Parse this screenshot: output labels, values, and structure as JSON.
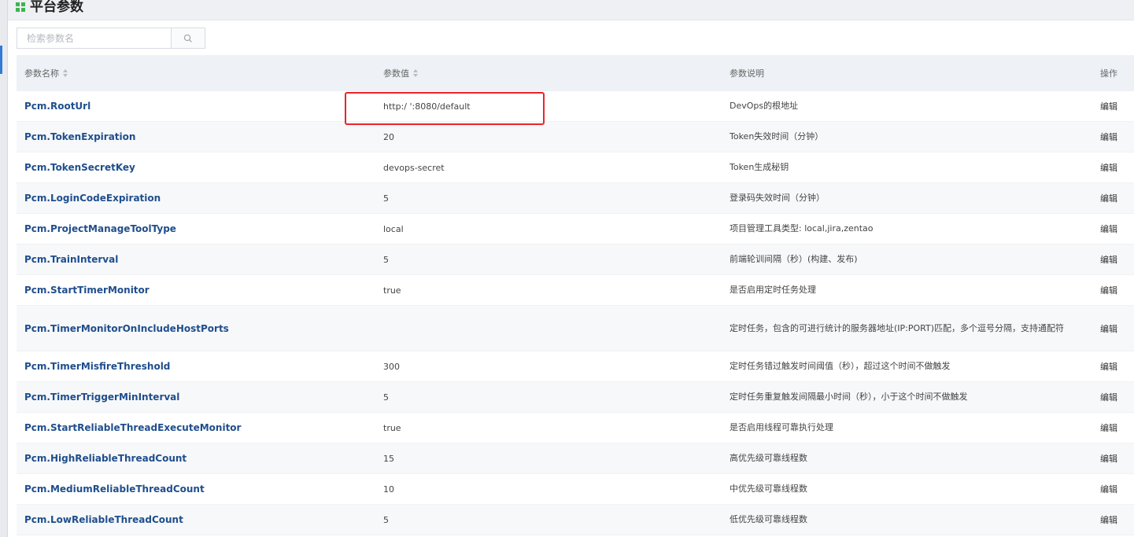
{
  "header": {
    "title": "平台参数"
  },
  "search": {
    "placeholder": "检索参数名"
  },
  "table": {
    "columns": [
      "参数名称",
      "参数值",
      "参数说明",
      "操作"
    ],
    "rows": [
      {
        "name": "Pcm.RootUrl",
        "value": "http:/                    ':8080/default",
        "desc": "DevOps的根地址",
        "op": "编辑"
      },
      {
        "name": "Pcm.TokenExpiration",
        "value": "20",
        "desc": "Token失效时间（分钟）",
        "op": "编辑"
      },
      {
        "name": "Pcm.TokenSecretKey",
        "value": "devops-secret",
        "desc": "Token生成秘钥",
        "op": "编辑"
      },
      {
        "name": "Pcm.LoginCodeExpiration",
        "value": "5",
        "desc": "登录码失效时间（分钟）",
        "op": "编辑"
      },
      {
        "name": "Pcm.ProjectManageToolType",
        "value": "local",
        "desc": "项目管理工具类型: local,jira,zentao",
        "op": "编辑"
      },
      {
        "name": "Pcm.TrainInterval",
        "value": "5",
        "desc": "前端轮训间隔（秒）(构建、发布)",
        "op": "编辑"
      },
      {
        "name": "Pcm.StartTimerMonitor",
        "value": "true",
        "desc": "是否启用定时任务处理",
        "op": "编辑"
      },
      {
        "name": "Pcm.TimerMonitorOnIncludeHostPorts",
        "value": "",
        "desc": "定时任务，包含的可进行统计的服务器地址(IP:PORT)匹配，多个逗号分隔，支持通配符",
        "op": "编辑"
      },
      {
        "name": "Pcm.TimerMisfireThreshold",
        "value": "300",
        "desc": "定时任务错过触发时间阈值（秒），超过这个时间不做触发",
        "op": "编辑"
      },
      {
        "name": "Pcm.TimerTriggerMinInterval",
        "value": "5",
        "desc": "定时任务重复触发间隔最小时间（秒），小于这个时间不做触发",
        "op": "编辑"
      },
      {
        "name": "Pcm.StartReliableThreadExecuteMonitor",
        "value": "true",
        "desc": "是否启用线程可靠执行处理",
        "op": "编辑"
      },
      {
        "name": "Pcm.HighReliableThreadCount",
        "value": "15",
        "desc": "高优先级可靠线程数",
        "op": "编辑"
      },
      {
        "name": "Pcm.MediumReliableThreadCount",
        "value": "10",
        "desc": "中优先级可靠线程数",
        "op": "编辑"
      },
      {
        "name": "Pcm.LowReliableThreadCount",
        "value": "5",
        "desc": "低优先级可靠线程数",
        "op": "编辑"
      }
    ]
  },
  "colors": {
    "accent": "#1f4e8c",
    "highlight": "#e8262a",
    "title_icon": "#3fb34f"
  }
}
